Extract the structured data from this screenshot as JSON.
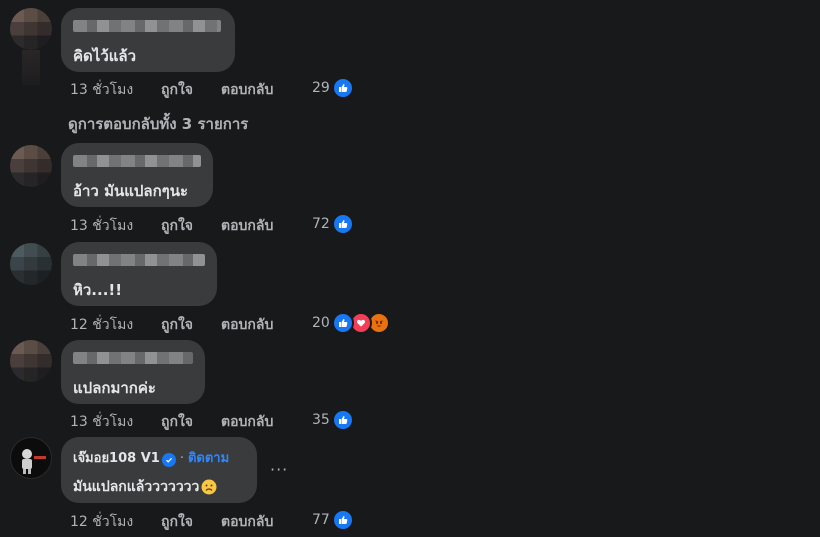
{
  "actions": {
    "like": "ถูกใจ",
    "reply": "ตอบกลับ"
  },
  "view_replies": "ดูการตอบกลับทั้ง 3 รายการ",
  "comments": [
    {
      "text": "คิดไว้แล้ว",
      "time": "13 ชั่วโมง",
      "reactions": "29"
    },
    {
      "text": "อ้าว มันแปลกๆนะ",
      "time": "13 ชั่วโมง",
      "reactions": "72"
    },
    {
      "text": "หิว...!!",
      "time": "12 ชั่วโมง",
      "reactions": "20"
    },
    {
      "text": "แปลกมากค่ะ",
      "time": "13 ชั่วโมง",
      "reactions": "35"
    },
    {
      "author": "เจ๊มอย108 V1",
      "follow": "ติดตาม",
      "text": "มันแปลกแล้ววววววว",
      "time": "12 ชั่วโมง",
      "reactions": "77"
    }
  ],
  "more_label": "···"
}
